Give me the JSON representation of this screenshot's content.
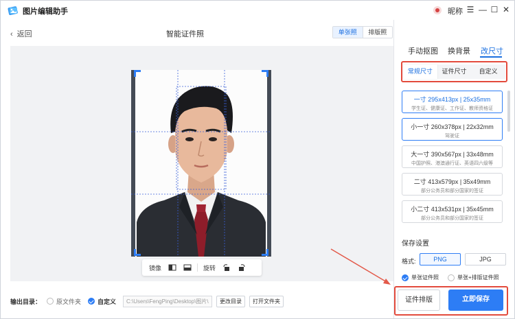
{
  "app": {
    "title": "图片编辑助手",
    "user_name": "昵称"
  },
  "toolbar": {
    "back_label": "返回",
    "page_title": "智能证件照",
    "mode_tabs": [
      {
        "label": "单张照"
      },
      {
        "label": "排版照"
      }
    ]
  },
  "photo_controls": {
    "mirror_label": "镜像",
    "rotate_label": "旋转"
  },
  "output": {
    "label": "输出目录：",
    "option_original": "原文件夹",
    "option_custom": "自定义",
    "path": "C:\\Users\\FengPing\\Desktop\\图片\\",
    "change_btn": "更改目录",
    "open_btn": "打开文件夹"
  },
  "right_tabs": [
    {
      "label": "手动抠图"
    },
    {
      "label": "换背景"
    },
    {
      "label": "改尺寸"
    }
  ],
  "size_tabs": [
    {
      "label": "常规尺寸"
    },
    {
      "label": "证件尺寸"
    },
    {
      "label": "自定义"
    }
  ],
  "sizes": [
    {
      "title": "一寸 295x413px | 25x35mm",
      "sub": "学生证、健康证、工作证、教师资格证"
    },
    {
      "title": "小一寸 260x378px | 22x32mm",
      "sub": "驾驶证"
    },
    {
      "title": "大一寸 390x567px | 33x48mm",
      "sub": "中国护照、港澳通行证、英语四六级等"
    },
    {
      "title": "二寸 413x579px | 35x49mm",
      "sub": "部分公务员和部分国家的签证"
    },
    {
      "title": "小二寸 413x531px | 35x45mm",
      "sub": "部分公务员和部分国家的签证"
    }
  ],
  "save": {
    "header": "保存设置",
    "format_label": "格式:",
    "formats": [
      {
        "label": "PNG"
      },
      {
        "label": "JPG"
      }
    ],
    "option_single": "单张证件照",
    "option_both": "单张+排版证件照",
    "layout_btn": "证件排版",
    "save_btn": "立即保存"
  },
  "colors": {
    "accent": "#2d7df5",
    "highlight_box": "#e34a3c",
    "arrow": "#e35a4a"
  }
}
